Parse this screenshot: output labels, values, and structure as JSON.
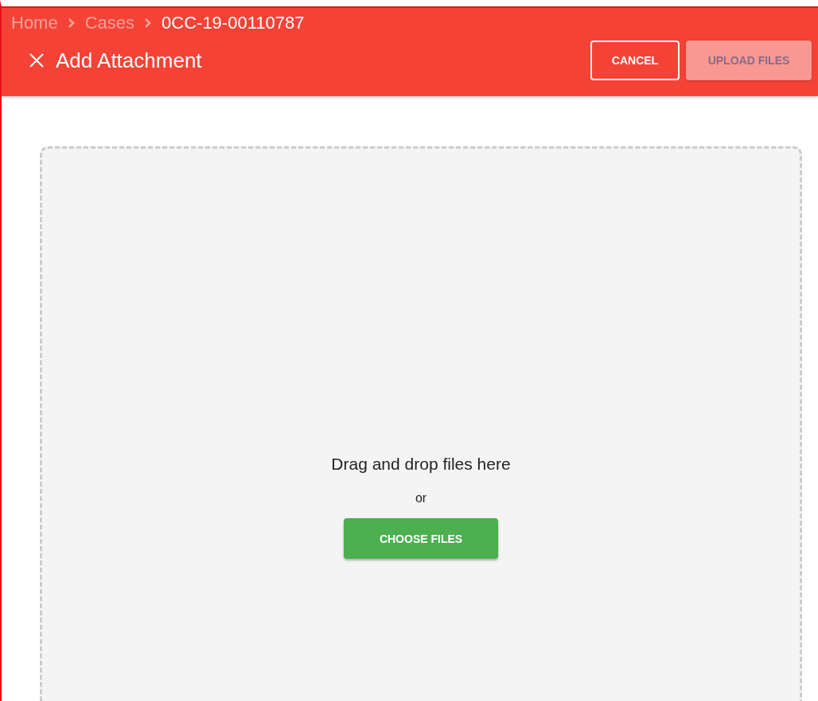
{
  "breadcrumbs": [
    {
      "label": "Home",
      "current": false
    },
    {
      "label": "Cases",
      "current": false
    },
    {
      "label": "0CC-19-00110787",
      "current": true
    }
  ],
  "title": "Add Attachment",
  "actions": [
    {
      "label": "CANCEL",
      "kind": "outline",
      "disabled": false
    },
    {
      "label": "UPLOAD FILES",
      "kind": "filled",
      "disabled": true
    }
  ],
  "dropzone": {
    "prompt": "Drag and drop files here",
    "separator": "or",
    "button": "CHOOSE FILES"
  }
}
